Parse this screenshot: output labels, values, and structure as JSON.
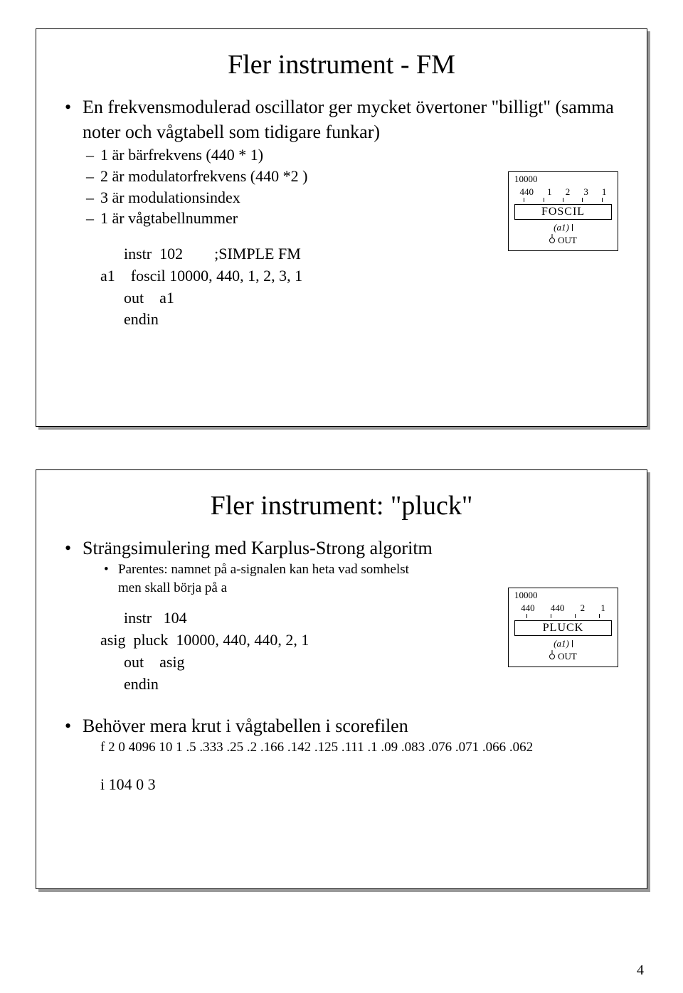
{
  "slide1": {
    "title": "Fler instrument - FM",
    "b1": "En frekvensmodulerad oscillator ger mycket övertoner \"billigt\" (samma noter och vågtabell som tidigare funkar)",
    "s1": "1 är bärfrekvens (440 * 1)",
    "s2": "2 är modulatorfrekvens (440 *2 )",
    "s3": "3 är modulationsindex",
    "s4": "1 är vågtabellnummer",
    "code": "      instr  102        ;SIMPLE FM\na1    foscil 10000, 440, 1, 2, 3, 1\n      out    a1\n      endin",
    "diag_top_amp": "10000",
    "diag_top_labels": [
      "440",
      "1",
      "2",
      "3",
      "1"
    ],
    "diag_box": "FOSCIL",
    "diag_sig": "(a1)",
    "diag_out": "OUT"
  },
  "slide2": {
    "title": "Fler instrument: \"pluck\"",
    "b1": "Strängsimulering med Karplus-Strong algoritm",
    "t1": "Parentes: namnet på a-signalen kan heta vad somhelst men skall börja på a",
    "code": "      instr   104\nasig  pluck  10000, 440, 440, 2, 1\n      out    asig\n      endin",
    "b2": "Behöver mera krut i  vågtabellen i scorefilen",
    "f_line": "f 2 0 4096 10 1 .5 .333 .25 .2 .166 .142 .125 .111 .1 .09 .083 .076 .071 .066 .062",
    "i_line": "i 104 0 3",
    "diag_top_amp": "10000",
    "diag_top_labels": [
      "440",
      "440",
      "2",
      "1"
    ],
    "diag_box": "PLUCK",
    "diag_sig": "(a1)",
    "diag_out": "OUT"
  },
  "page_number": "4"
}
